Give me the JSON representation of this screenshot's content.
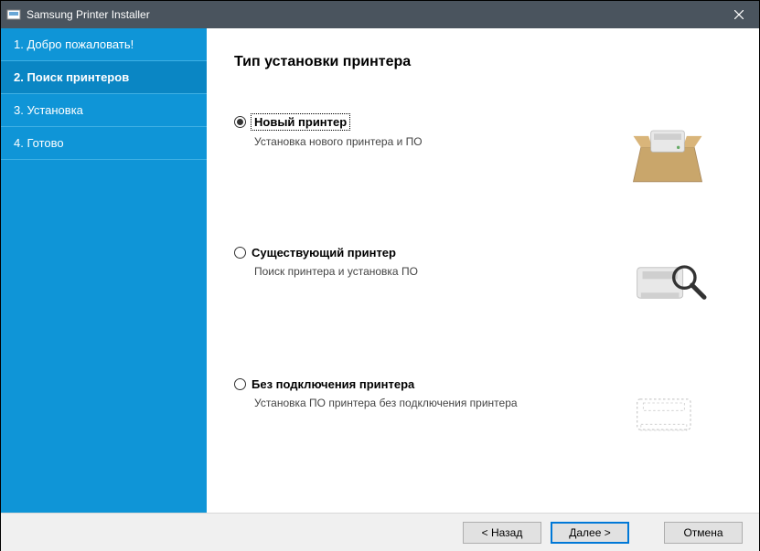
{
  "window": {
    "title": "Samsung Printer Installer"
  },
  "sidebar": {
    "steps": [
      {
        "label": "1. Добро пожаловать!"
      },
      {
        "label": "2. Поиск принтеров"
      },
      {
        "label": "3. Установка"
      },
      {
        "label": "4. Готово"
      }
    ]
  },
  "main": {
    "heading": "Тип установки принтера",
    "options": [
      {
        "title": "Новый принтер",
        "desc": "Установка нового принтера и ПО",
        "selected": true
      },
      {
        "title": "Существующий принтер",
        "desc": "Поиск принтера и установка ПО",
        "selected": false
      },
      {
        "title": "Без подключения принтера",
        "desc": "Установка ПО принтера без подключения принтера",
        "selected": false
      }
    ]
  },
  "footer": {
    "back": "< Назад",
    "next": "Далее >",
    "cancel": "Отмена"
  }
}
